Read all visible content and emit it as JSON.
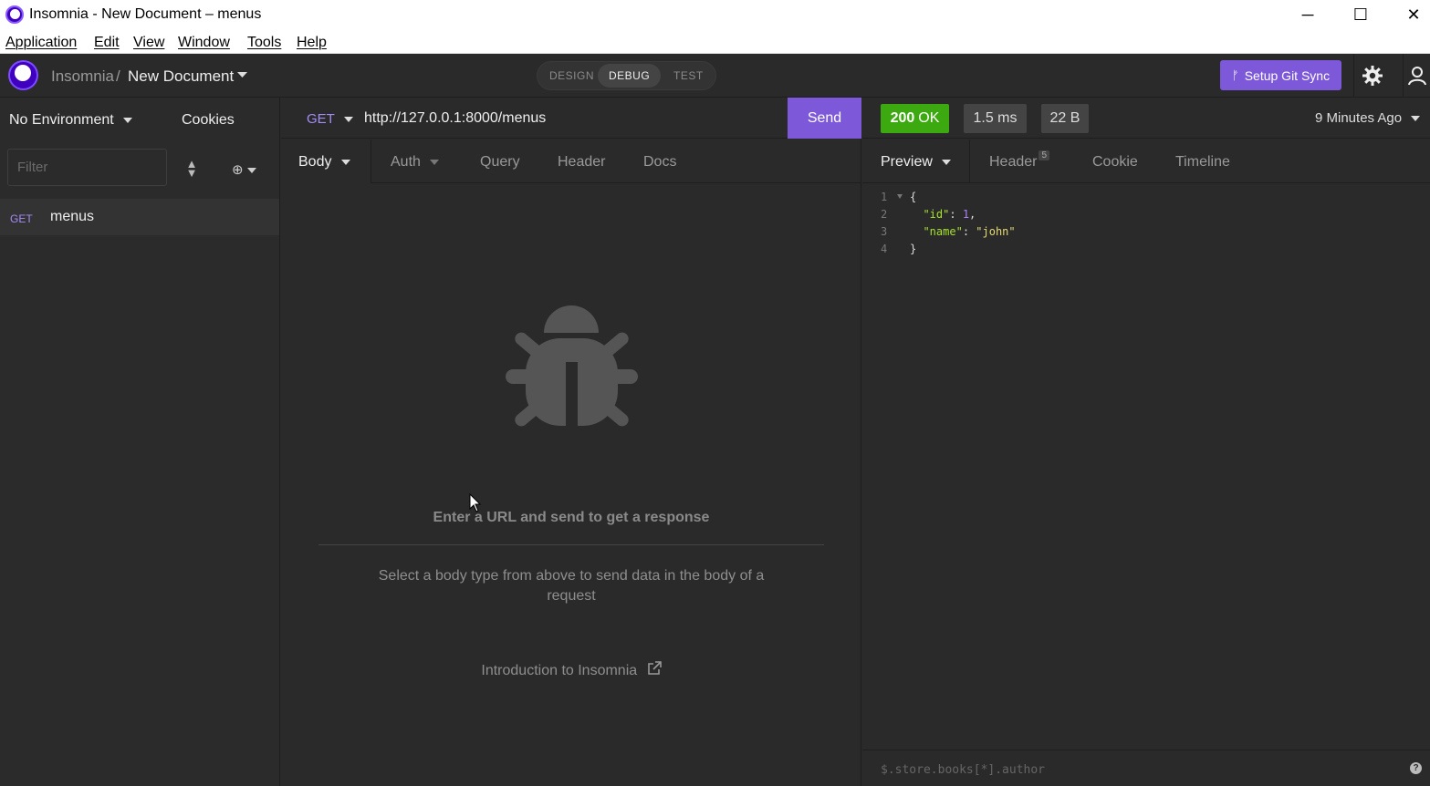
{
  "window": {
    "title": "Insomnia - New Document – menus",
    "controls": {
      "minimize": "─",
      "maximize": "☐",
      "close": "✕"
    }
  },
  "menubar": [
    "Application",
    "Edit",
    "View",
    "Window",
    "Tools",
    "Help"
  ],
  "header": {
    "breadcrumb_root": "Insomnia",
    "breadcrumb_sep": "/",
    "document": "New Document",
    "modes": [
      "DESIGN",
      "DEBUG",
      "TEST"
    ],
    "active_mode": "DEBUG",
    "git_sync_label": "Setup Git Sync"
  },
  "sidebar": {
    "environment": "No Environment",
    "cookies": "Cookies",
    "filter_placeholder": "Filter",
    "requests": [
      {
        "method": "GET",
        "name": "menus"
      }
    ]
  },
  "request": {
    "method": "GET",
    "url": "http://127.0.0.1:8000/menus",
    "send_label": "Send",
    "tabs": [
      "Body",
      "Auth",
      "Query",
      "Header",
      "Docs"
    ],
    "empty_title": "Enter a URL and send to get a response",
    "empty_body": "Select a body type from above to send data in the body of a request",
    "intro_link": "Introduction to Insomnia"
  },
  "response": {
    "status_code": "200",
    "status_text": "OK",
    "time": "1.5 ms",
    "size": "22 B",
    "ago": "9 Minutes Ago",
    "tabs": [
      "Preview",
      "Header",
      "Cookie",
      "Timeline"
    ],
    "header_count": "5",
    "filter_placeholder": "$.store.books[*].author",
    "lines": [
      "1",
      "2",
      "3",
      "4"
    ]
  },
  "colors": {
    "accent": "#7d58d9",
    "ok": "#3ba90f",
    "get": "#a58bf5"
  }
}
